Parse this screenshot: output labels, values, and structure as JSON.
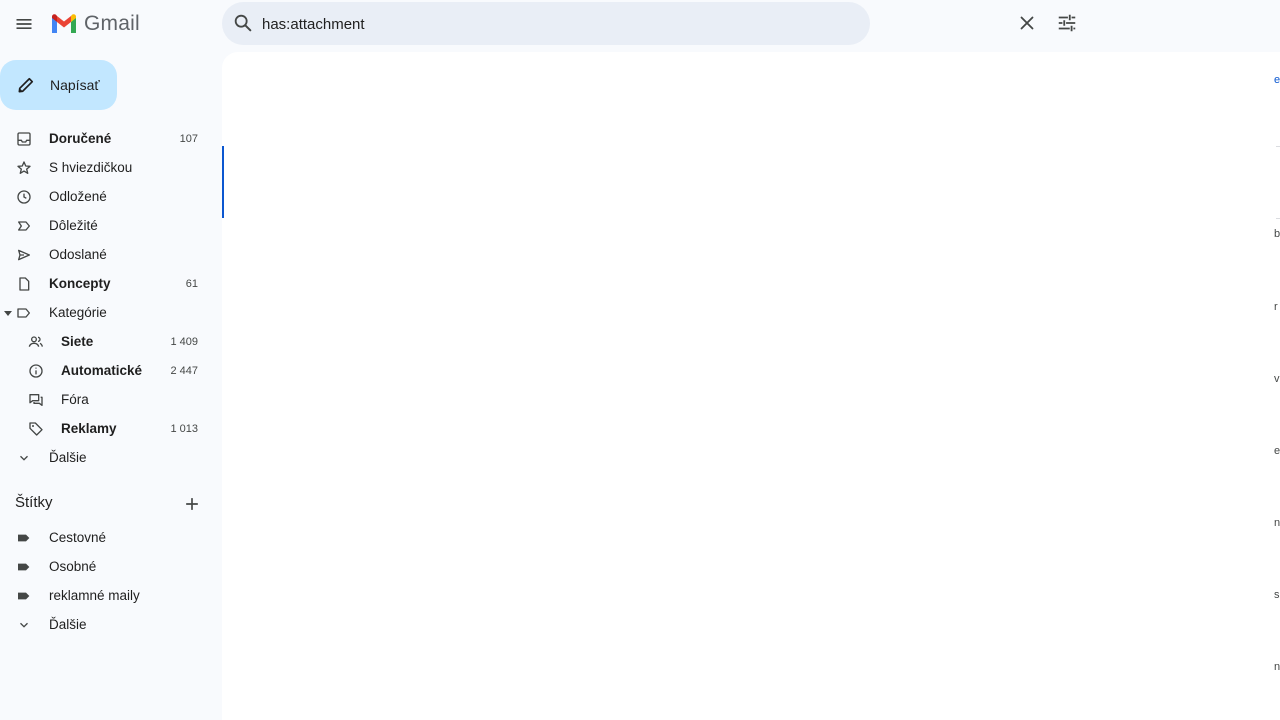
{
  "app": {
    "name": "Gmail"
  },
  "search": {
    "value": "has:attachment"
  },
  "compose": {
    "label": "Napísať"
  },
  "nav": {
    "items": [
      {
        "label": "Doručené",
        "count": "107",
        "icon": "inbox-icon",
        "bold": true
      },
      {
        "label": "S hviezdičkou",
        "count": "",
        "icon": "star-icon",
        "bold": false
      },
      {
        "label": "Odložené",
        "count": "",
        "icon": "clock-icon",
        "bold": false
      },
      {
        "label": "Dôležité",
        "count": "",
        "icon": "important-icon",
        "bold": false
      },
      {
        "label": "Odoslané",
        "count": "",
        "icon": "send-icon",
        "bold": false
      },
      {
        "label": "Koncepty",
        "count": "61",
        "icon": "draft-icon",
        "bold": true
      },
      {
        "label": "Kategórie",
        "count": "",
        "icon": "label-icon",
        "bold": false
      }
    ],
    "categories": [
      {
        "label": "Siete",
        "count": "1 409",
        "icon": "people-icon",
        "bold": true
      },
      {
        "label": "Automatické",
        "count": "2 447",
        "icon": "info-icon",
        "bold": true
      },
      {
        "label": "Fóra",
        "count": "",
        "icon": "forum-icon",
        "bold": false
      },
      {
        "label": "Reklamy",
        "count": "1 013",
        "icon": "tag-icon",
        "bold": true
      }
    ],
    "more_label": "Ďalšie"
  },
  "labels": {
    "title": "Štítky",
    "items": [
      {
        "label": "Cestovné"
      },
      {
        "label": "Osobné"
      },
      {
        "label": "reklamné maily"
      }
    ],
    "more_label": "Ďalšie"
  },
  "edge_fragments": [
    "e",
    "b",
    "r",
    "v",
    "e",
    "n",
    "s",
    "n"
  ],
  "colors": {
    "accent": "#0b57d0",
    "compose_bg": "#c2e7ff",
    "search_bg": "#e9eef6"
  }
}
